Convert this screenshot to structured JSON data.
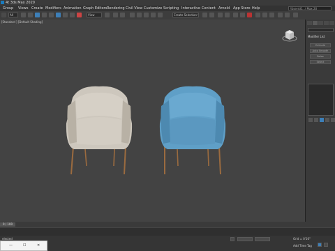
{
  "app": {
    "title": "4t 3ds Max 2020"
  },
  "menu": {
    "items": [
      "Group",
      "Views",
      "Create",
      "Modifiers",
      "Animation",
      "Graph Editors",
      "Rendering",
      "Civil View",
      "Customize",
      "Scripting",
      "Interactive",
      "Content",
      "Arnold",
      "App Store",
      "Help"
    ],
    "search_text": "\\Users\\Q...\\ Max 20"
  },
  "toolbar": {
    "filter_label": "All",
    "view_label": "View",
    "selection_set_label": "Create Selection Se"
  },
  "viewport": {
    "label": "[Standard ] [Default Shading]",
    "chairs": [
      {
        "name": "beige-chair",
        "fabric": "#cdc7bd",
        "fabric_shade": "#b8b1a5"
      },
      {
        "name": "blue-chair",
        "fabric": "#5f9fc7",
        "fabric_shade": "#4d89b0"
      }
    ],
    "leg_color": "#9b6b3f"
  },
  "command_panel": {
    "modifier_list_label": "Modifier List",
    "buttons": [
      "Extrude",
      "Auto Smooth",
      "Relax",
      "Select"
    ]
  },
  "timeline": {
    "time_label": "0 / 100"
  },
  "status": {
    "selection_text": "elected",
    "grid_text": "Grid = 0'10\"",
    "add_time_tag": "Add Time Tag"
  },
  "colors": {
    "accent": "#1a7bbd",
    "background": "#2b2b2b",
    "viewport": "#434343"
  }
}
